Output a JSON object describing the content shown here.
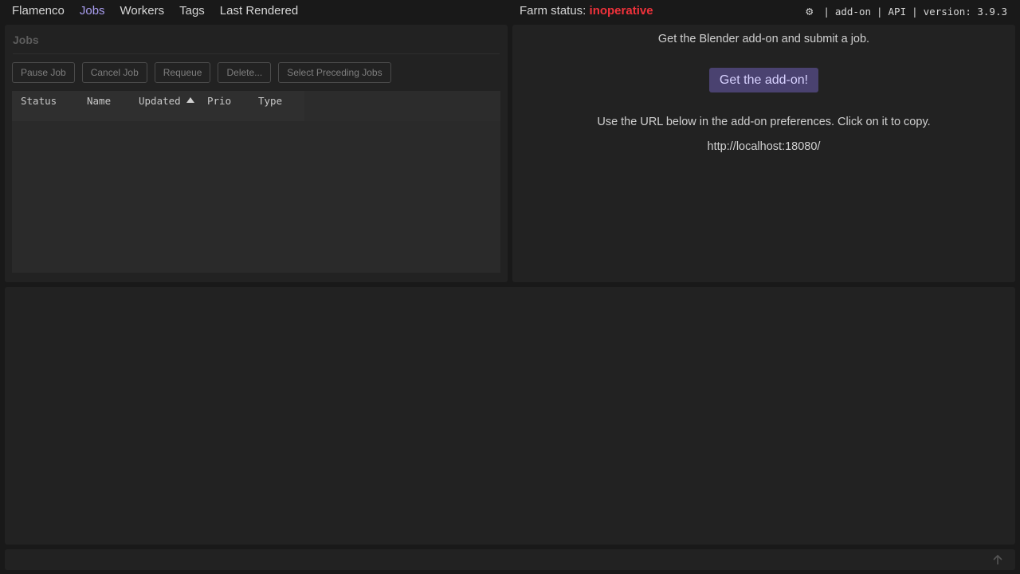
{
  "nav": {
    "brand": "Flamenco",
    "items": [
      {
        "label": "Jobs",
        "active": true
      },
      {
        "label": "Workers",
        "active": false
      },
      {
        "label": "Tags",
        "active": false
      },
      {
        "label": "Last Rendered",
        "active": false
      }
    ]
  },
  "farm_status": {
    "label": "Farm status:",
    "value": "inoperative",
    "value_color": "#f0323b"
  },
  "top_links": {
    "gear_icon": "gear-icon",
    "separator": "|",
    "addon": "add-on",
    "api": "API",
    "version": "version: 3.9.3"
  },
  "jobs": {
    "title": "Jobs",
    "buttons": {
      "pause": "Pause Job",
      "cancel": "Cancel Job",
      "requeue": "Requeue",
      "delete": "Delete...",
      "select_preceding": "Select Preceding Jobs"
    },
    "columns": {
      "status": "Status",
      "name": "Name",
      "updated": "Updated",
      "prio": "Prio",
      "type": "Type"
    },
    "sort_icon": "sort-ascending-icon"
  },
  "addon": {
    "intro": "Get the Blender add-on and submit a job.",
    "button": "Get the add-on!",
    "url_hint": "Use the URL below in the add-on preferences. Click on it to copy.",
    "url": "http://localhost:18080/",
    "accent_color": "#4a4270"
  },
  "footer": {
    "icon": "arrow-up-icon"
  }
}
